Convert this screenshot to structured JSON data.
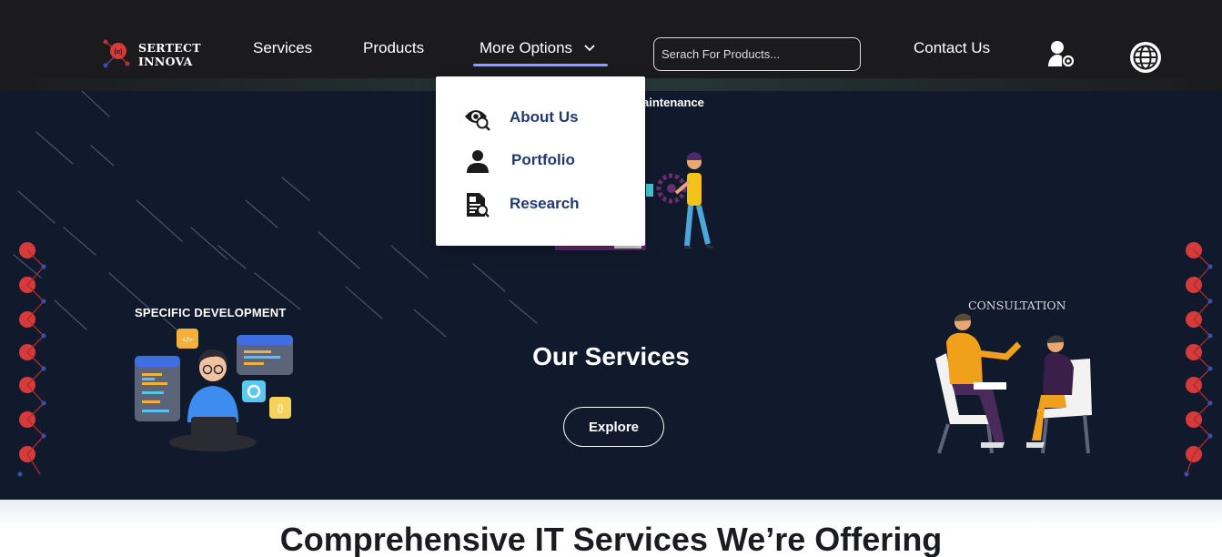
{
  "nav": {
    "logo_line1": "SERTECT",
    "logo_line2": "INNOVA",
    "services": "Services",
    "products": "Products",
    "more_options": "More Options",
    "search_placeholder": "Serach For Products...",
    "contact": "Contact Us"
  },
  "dropdown": {
    "items": [
      {
        "label": "About Us",
        "icon": "eye-search-icon"
      },
      {
        "label": "Portfolio",
        "icon": "person-icon"
      },
      {
        "label": "Research",
        "icon": "document-search-icon"
      }
    ]
  },
  "hero": {
    "maintenance_label": "aintenance",
    "development_label": "SPECIFIC DEVELOPMENT",
    "consultation_label": "CONSULTATION",
    "title": "Our Services",
    "explore_button": "Explore"
  },
  "section": {
    "title": "Comprehensive IT Services We’re Offering"
  },
  "colors": {
    "nav_bg": "#1b1b1d",
    "hero_bg": "#111a2c",
    "accent_underline": "#8ea0ee",
    "dropdown_text": "#1f3a6e",
    "logo_red": "#d63a3a"
  }
}
